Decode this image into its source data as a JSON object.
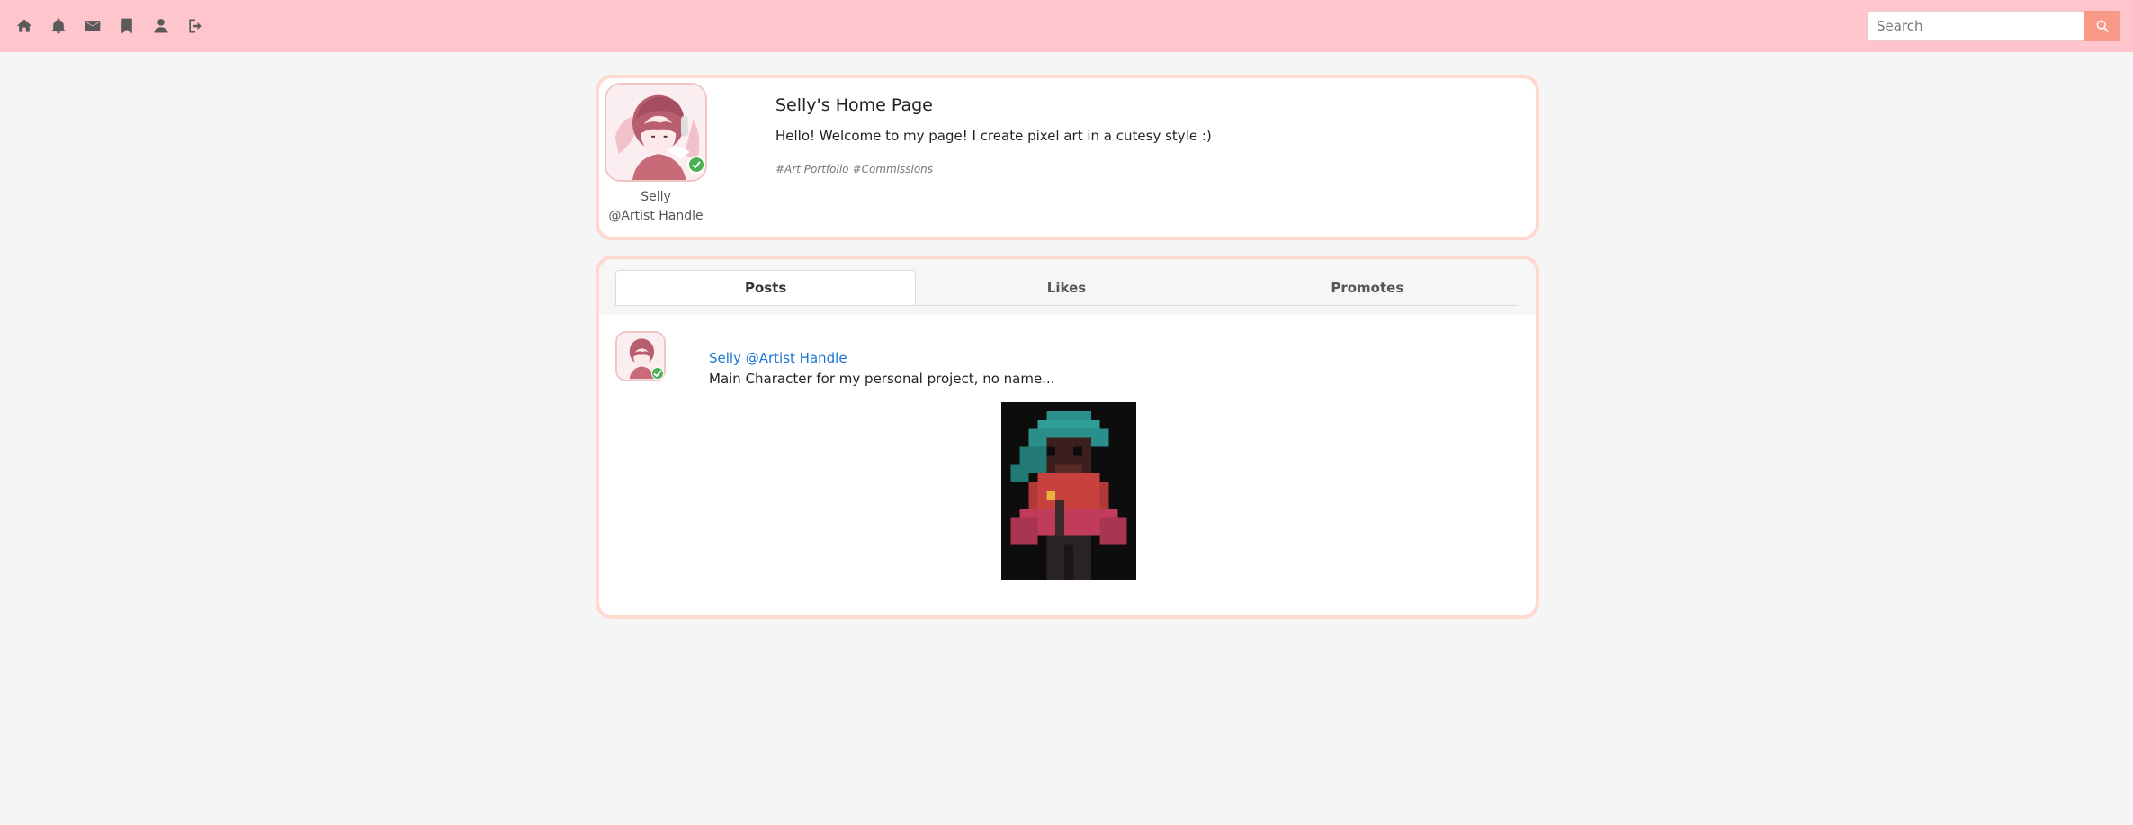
{
  "nav": {
    "icons": [
      "home-icon",
      "bell-icon",
      "mail-icon",
      "bookmark-icon",
      "user-icon",
      "logout-icon"
    ]
  },
  "search": {
    "placeholder": "Search",
    "value": "",
    "button_icon": "search-icon"
  },
  "profile": {
    "name": "Selly",
    "handle": "@Artist Handle",
    "page_title": "Selly's Home Page",
    "bio": "Hello! Welcome to my page! I create pixel art in a cutesy style :)",
    "tags": [
      "#Art Portfolio",
      "#Commissions"
    ],
    "verified_badge": "check-icon"
  },
  "tabs": [
    {
      "label": "Posts",
      "active": true
    },
    {
      "label": "Likes",
      "active": false
    },
    {
      "label": "Promotes",
      "active": false
    }
  ],
  "post": {
    "author": "Selly @Artist Handle",
    "text": "Main Character for my personal project, no name..."
  },
  "colors": {
    "topbar": "#ffc5cc",
    "card_border": "#ffd8cf",
    "search_button": "#f89a86",
    "link": "#1976d2",
    "badge": "#4caf50"
  }
}
